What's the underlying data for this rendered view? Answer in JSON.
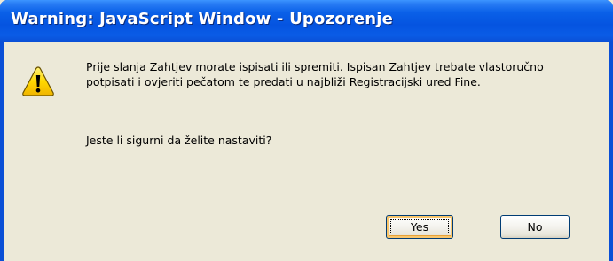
{
  "window": {
    "title": "Warning: JavaScript Window - Upozorenje"
  },
  "dialog": {
    "icon": "warning-icon",
    "message": "Prije slanja Zahtjev morate ispisati ili spremiti. Ispisan Zahtjev trebate vlastoručno potpisati i ovjeriti pečatom te predati u najbliži Registracijski ured Fine.",
    "question": "Jeste li sigurni da želite nastaviti?"
  },
  "buttons": {
    "yes_label": "Yes",
    "no_label": "No"
  },
  "colors": {
    "titlebar": "#0a5ce6",
    "client_background": "#ece9d8",
    "warning_icon_fill": "#ffd800"
  }
}
